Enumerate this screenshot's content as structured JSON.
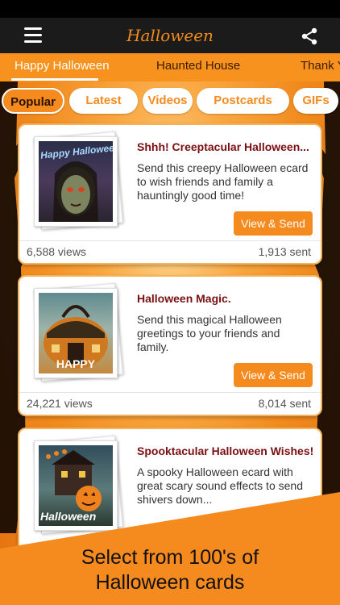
{
  "app": {
    "title": "Halloween"
  },
  "tabs": [
    "Happy Halloween",
    "Haunted House",
    "Thank Y"
  ],
  "filters": [
    "Popular",
    "Latest",
    "Videos",
    "Postcards",
    "GIFs"
  ],
  "cards": [
    {
      "title": "Shhh! Creeptacular Halloween...",
      "description": "Send this creepy Halloween ecard to wish friends and family a hauntingly good time!",
      "button": "View & Send",
      "views": "6,588 views",
      "sent": "1,913 sent",
      "thumb_text": "Happy Halloween"
    },
    {
      "title": "Halloween Magic.",
      "description": "Send this magical Halloween greetings to your friends and family.",
      "button": "View & Send",
      "views": "24,221 views",
      "sent": "8,014 sent",
      "thumb_text": "HAPPY"
    },
    {
      "title": "Spooktacular Halloween Wishes!",
      "description": "A spooky Halloween ecard with great scary sound effects to send shivers down...",
      "thumb_text": "Halloween"
    }
  ],
  "promo": {
    "line1": "Select from 100's of",
    "line2": "Halloween cards"
  },
  "colors": {
    "accent": "#f58a1f",
    "title_orange": "#f28a1c",
    "card_title": "#7a0f12",
    "topbar": "#1b1b1b"
  },
  "icons": {
    "menu": "hamburger-menu-icon",
    "share": "share-icon"
  }
}
